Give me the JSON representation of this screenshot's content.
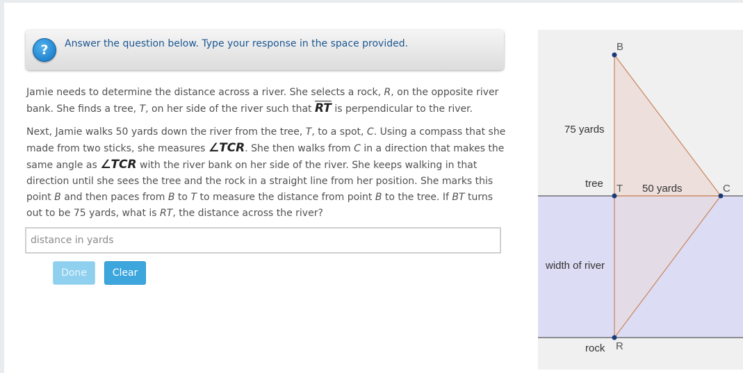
{
  "instruction": {
    "icon": "help-icon",
    "icon_glyph": "?",
    "text": "Answer the question below. Type your response in the space provided."
  },
  "question": {
    "p1": [
      "Jamie needs to determine the distance across a river. She selects a rock, ",
      "R",
      ", on the opposite river bank. She finds a tree, ",
      "T",
      ", on her side of the river such that ",
      "RT",
      " is perpendicular to the river."
    ],
    "p2": [
      "Next, Jamie walks 50 yards down the river from the tree, ",
      "T",
      ", to a spot, ",
      "C",
      ". Using a compass that she made from two sticks, she measures ",
      "∠TCR",
      ". She then walks from ",
      "C",
      " in a direction that makes the same angle as ",
      "∠TCR",
      " with the river bank on her side of the river. She keeps walking in that direction until she sees the tree and the rock in a straight line from her position. She marks this point ",
      "B",
      " and then paces from ",
      "B",
      " to ",
      "T",
      " to measure the distance from point ",
      "B",
      " to the tree. If ",
      "BT",
      " turns out to be 75 yards, what is ",
      "RT",
      ", the distance across the river?"
    ]
  },
  "answer": {
    "placeholder": "distance in yards",
    "value": ""
  },
  "buttons": {
    "done": "Done",
    "clear": "Clear"
  },
  "diagram": {
    "points": {
      "B": "B",
      "T": "T",
      "C": "C",
      "R": "R"
    },
    "labels": {
      "bt": "75 yards",
      "tree": "tree",
      "tc": "50 yards",
      "river": "width of river",
      "rock": "rock"
    },
    "colors": {
      "panel": "#f0f0f0",
      "river": "#dcdcf5",
      "triangle_fill": "#ecdcd8",
      "triangle_stroke": "#c8845a",
      "point": "#1a3a7a"
    }
  }
}
